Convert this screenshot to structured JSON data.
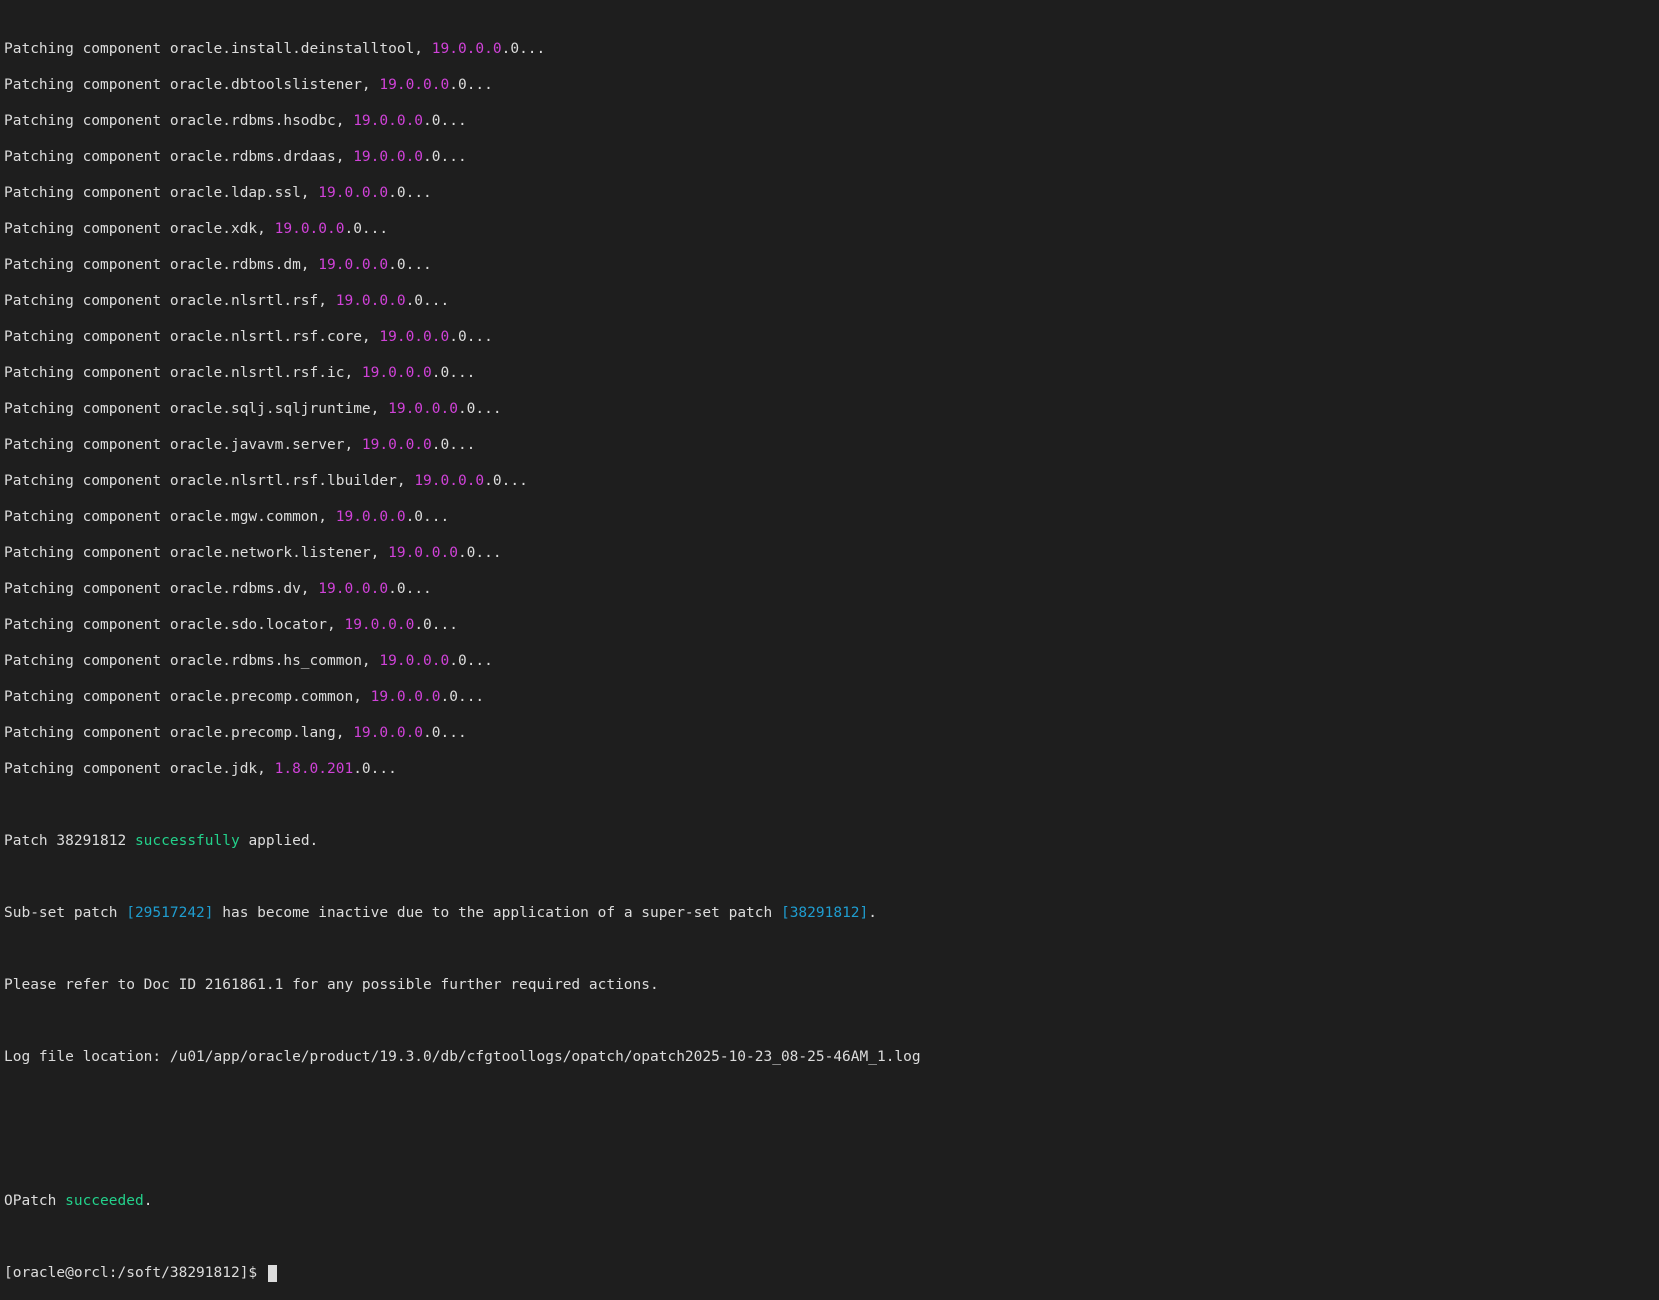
{
  "components": [
    {
      "prefix": "Patching component oracle.install.deinstalltool, ",
      "version": "19.0.0.0",
      "suffix": ".0..."
    },
    {
      "prefix": "Patching component oracle.dbtoolslistener, ",
      "version": "19.0.0.0",
      "suffix": ".0..."
    },
    {
      "prefix": "Patching component oracle.rdbms.hsodbc, ",
      "version": "19.0.0.0",
      "suffix": ".0..."
    },
    {
      "prefix": "Patching component oracle.rdbms.drdaas, ",
      "version": "19.0.0.0",
      "suffix": ".0..."
    },
    {
      "prefix": "Patching component oracle.ldap.ssl, ",
      "version": "19.0.0.0",
      "suffix": ".0..."
    },
    {
      "prefix": "Patching component oracle.xdk, ",
      "version": "19.0.0.0",
      "suffix": ".0..."
    },
    {
      "prefix": "Patching component oracle.rdbms.dm, ",
      "version": "19.0.0.0",
      "suffix": ".0..."
    },
    {
      "prefix": "Patching component oracle.nlsrtl.rsf, ",
      "version": "19.0.0.0",
      "suffix": ".0..."
    },
    {
      "prefix": "Patching component oracle.nlsrtl.rsf.core, ",
      "version": "19.0.0.0",
      "suffix": ".0..."
    },
    {
      "prefix": "Patching component oracle.nlsrtl.rsf.ic, ",
      "version": "19.0.0.0",
      "suffix": ".0..."
    },
    {
      "prefix": "Patching component oracle.sqlj.sqljruntime, ",
      "version": "19.0.0.0",
      "suffix": ".0..."
    },
    {
      "prefix": "Patching component oracle.javavm.server, ",
      "version": "19.0.0.0",
      "suffix": ".0..."
    },
    {
      "prefix": "Patching component oracle.nlsrtl.rsf.lbuilder, ",
      "version": "19.0.0.0",
      "suffix": ".0..."
    },
    {
      "prefix": "Patching component oracle.mgw.common, ",
      "version": "19.0.0.0",
      "suffix": ".0..."
    },
    {
      "prefix": "Patching component oracle.network.listener, ",
      "version": "19.0.0.0",
      "suffix": ".0..."
    },
    {
      "prefix": "Patching component oracle.rdbms.dv, ",
      "version": "19.0.0.0",
      "suffix": ".0..."
    },
    {
      "prefix": "Patching component oracle.sdo.locator, ",
      "version": "19.0.0.0",
      "suffix": ".0..."
    },
    {
      "prefix": "Patching component oracle.rdbms.hs_common, ",
      "version": "19.0.0.0",
      "suffix": ".0..."
    },
    {
      "prefix": "Patching component oracle.precomp.common, ",
      "version": "19.0.0.0",
      "suffix": ".0..."
    },
    {
      "prefix": "Patching component oracle.precomp.lang, ",
      "version": "19.0.0.0",
      "suffix": ".0..."
    },
    {
      "prefix": "Patching component oracle.jdk, ",
      "version": "1.8.0.201",
      "suffix": ".0..."
    }
  ],
  "result": {
    "applied_prefix": "Patch 38291812 ",
    "applied_word": "successfully",
    "applied_suffix": " applied.",
    "subset_prefix": "Sub-set patch ",
    "subset_patch": "[29517242]",
    "subset_middle": " has become inactive due to the application of a super-set patch ",
    "superset_patch": "[38291812]",
    "subset_suffix": ".",
    "doc_line": "Please refer to Doc ID 2161861.1 for any possible further required actions.",
    "log_line": "Log file location: /u01/app/oracle/product/19.3.0/db/cfgtoollogs/opatch/opatch2025-10-23_08-25-46AM_1.log",
    "opatch_prefix": "OPatch ",
    "opatch_word": "succeeded",
    "opatch_suffix": "."
  },
  "prompt": {
    "text": "[oracle@orcl:/soft/38291812]$ "
  },
  "colors": {
    "background": "#1e1e1e",
    "text": "#dcdcdc",
    "version": "#d042d8",
    "patch_id": "#1f9dd0",
    "success": "#23d18b"
  }
}
